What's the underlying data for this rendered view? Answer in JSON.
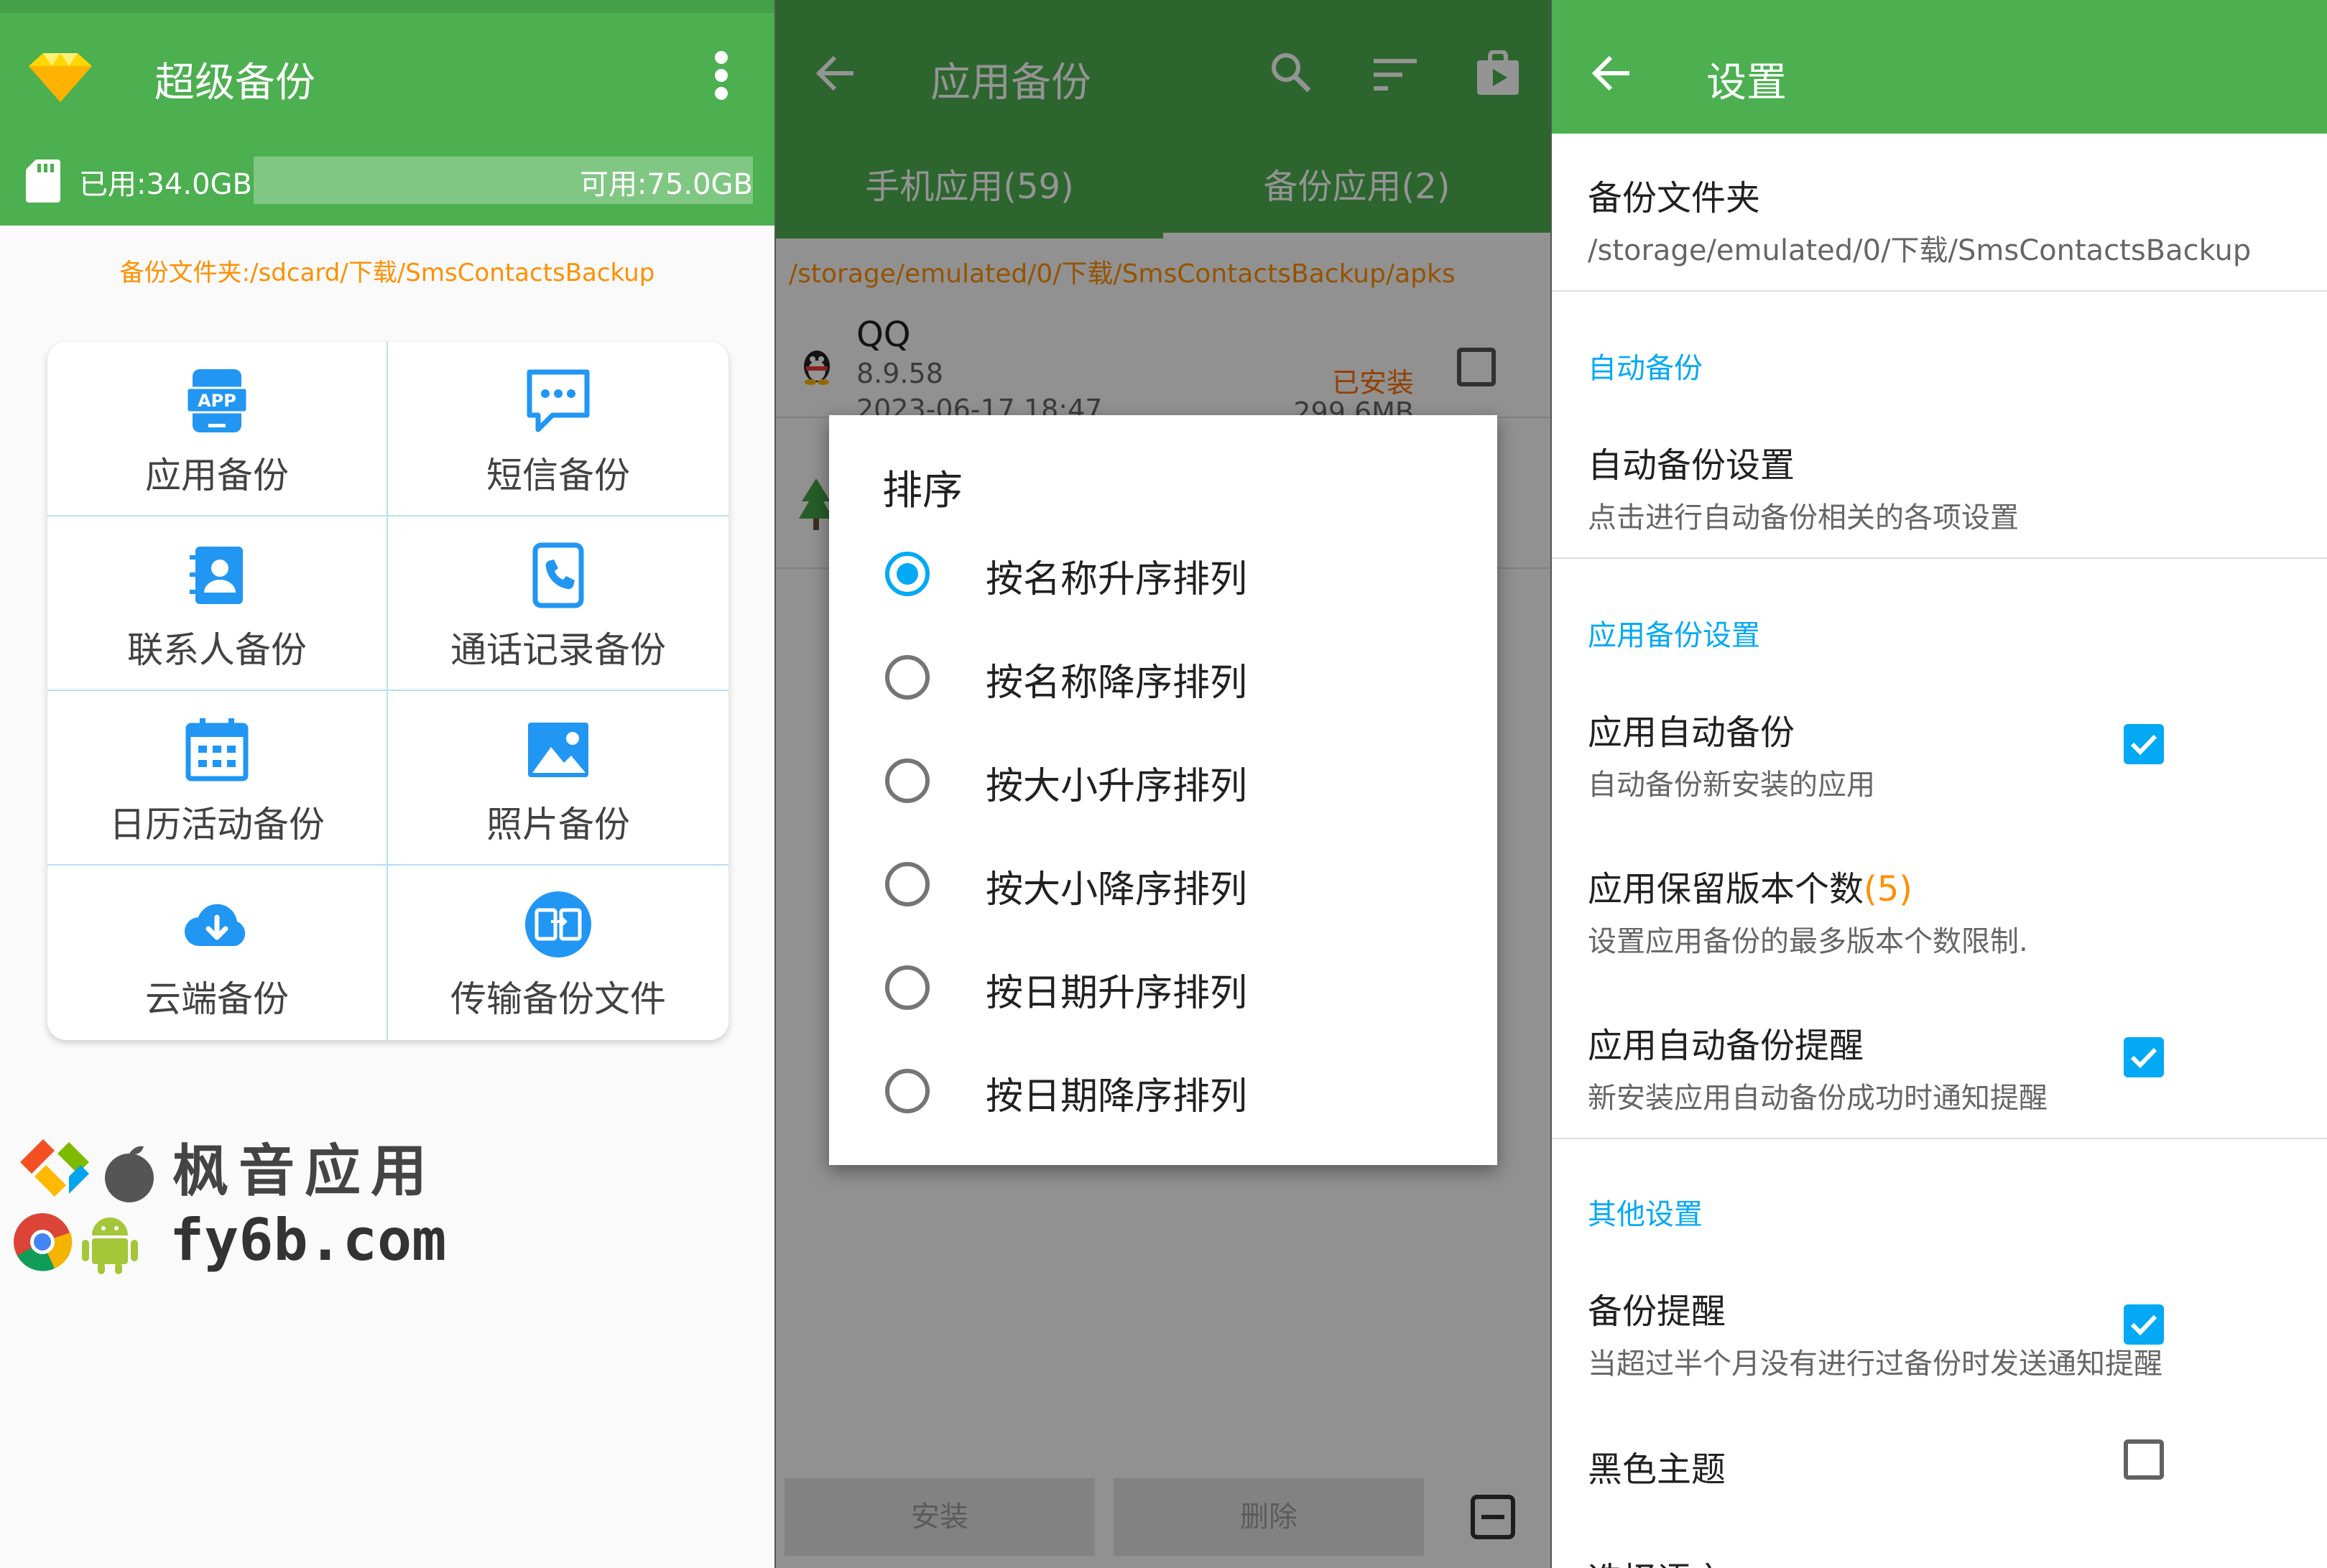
{
  "colors": {
    "primary": "#4caf50",
    "accent": "#03a9f4",
    "orange": "#ff8f00"
  },
  "panel1": {
    "title": "超级备份",
    "storage": {
      "used": "已用:34.0GB",
      "free": "可用:75.0GB"
    },
    "folder": "备份文件夹:/sdcard/下载/SmsContactsBackup",
    "tiles": [
      {
        "label": "应用备份",
        "icon": "app-icon"
      },
      {
        "label": "短信备份",
        "icon": "sms-icon"
      },
      {
        "label": "联系人备份",
        "icon": "contacts-icon"
      },
      {
        "label": "通话记录备份",
        "icon": "call-log-icon"
      },
      {
        "label": "日历活动备份",
        "icon": "calendar-icon"
      },
      {
        "label": "照片备份",
        "icon": "photo-icon"
      },
      {
        "label": "云端备份",
        "icon": "cloud-icon"
      },
      {
        "label": "传输备份文件",
        "icon": "transfer-icon"
      }
    ],
    "watermark": {
      "line1": "枫音应用",
      "line2": "fy6b.com"
    }
  },
  "panel2": {
    "title": "应用备份",
    "tabs": [
      "手机应用(59)",
      "备份应用(2)"
    ],
    "path": "/storage/emulated/0/下载/SmsContactsBackup/apks",
    "apps": [
      {
        "name": "QQ",
        "version": "8.9.58",
        "date": "2023-06-17 18:47",
        "status": "已安装",
        "size": "299.6MB"
      }
    ],
    "bottom": {
      "install": "安装",
      "delete": "删除"
    },
    "dialog": {
      "title": "排序",
      "options": [
        "按名称升序排列",
        "按名称降序排列",
        "按大小升序排列",
        "按大小降序排列",
        "按日期升序排列",
        "按日期降序排列"
      ],
      "selected_index": 0
    }
  },
  "panel3": {
    "title": "设置",
    "folder": {
      "title": "备份文件夹",
      "path": "/storage/emulated/0/下载/SmsContactsBackup"
    },
    "cat_auto": "自动备份",
    "auto_settings": {
      "title": "自动备份设置",
      "sub": "点击进行自动备份相关的各项设置"
    },
    "cat_app": "应用备份设置",
    "app_auto": {
      "title": "应用自动备份",
      "sub": "自动备份新安装的应用",
      "checked": true
    },
    "keep": {
      "title": "应用保留版本个数",
      "count": "(5)",
      "sub": "设置应用备份的最多版本个数限制."
    },
    "remind": {
      "title": "应用自动备份提醒",
      "sub": "新安装应用自动备份成功时通知提醒",
      "checked": true
    },
    "cat_other": "其他设置",
    "backup_remind": {
      "title": "备份提醒",
      "sub": "当超过半个月没有进行过备份时发送通知提醒",
      "checked": true
    },
    "dark": {
      "title": "黑色主题",
      "checked": false
    },
    "language": {
      "title": "选择语言"
    }
  }
}
